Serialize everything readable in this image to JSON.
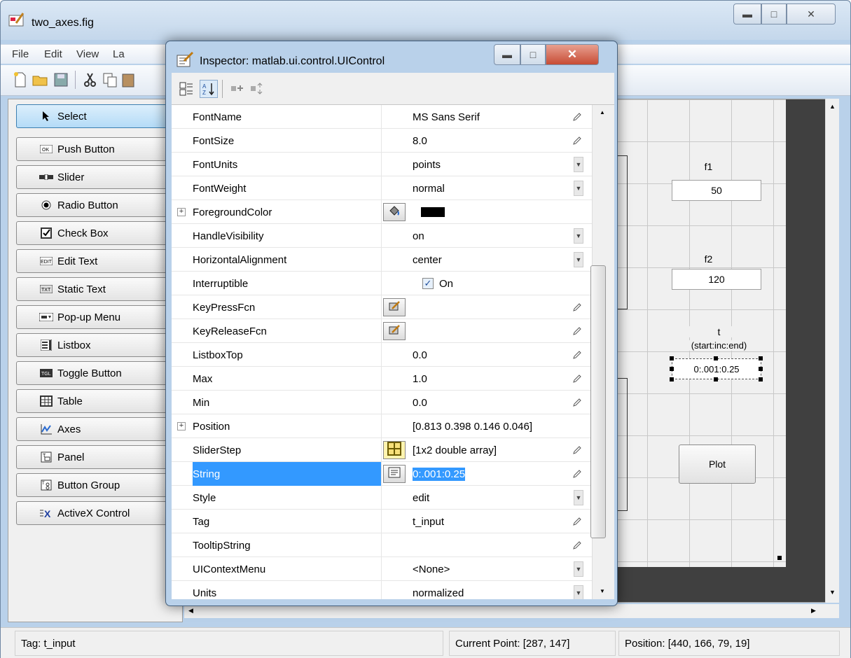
{
  "main_window": {
    "title": "two_axes.fig",
    "menu": [
      "File",
      "Edit",
      "View",
      "La"
    ]
  },
  "palette": {
    "items": [
      {
        "label": "Select",
        "icon": "cursor-arrow-icon",
        "selected": true
      },
      {
        "label": "Push Button",
        "icon": "push-button-icon"
      },
      {
        "label": "Slider",
        "icon": "slider-icon"
      },
      {
        "label": "Radio Button",
        "icon": "radio-button-icon"
      },
      {
        "label": "Check Box",
        "icon": "check-box-icon"
      },
      {
        "label": "Edit Text",
        "icon": "edit-text-icon"
      },
      {
        "label": "Static Text",
        "icon": "static-text-icon"
      },
      {
        "label": "Pop-up Menu",
        "icon": "popup-menu-icon"
      },
      {
        "label": "Listbox",
        "icon": "listbox-icon"
      },
      {
        "label": "Toggle Button",
        "icon": "toggle-button-icon"
      },
      {
        "label": "Table",
        "icon": "table-icon"
      },
      {
        "label": "Axes",
        "icon": "axes-icon"
      },
      {
        "label": "Panel",
        "icon": "panel-icon"
      },
      {
        "label": "Button Group",
        "icon": "button-group-icon"
      },
      {
        "label": "ActiveX Control",
        "icon": "activex-icon"
      }
    ]
  },
  "figure": {
    "f1_label": "f1",
    "f1_value": "50",
    "f2_label": "f2",
    "f2_value": "120",
    "t_label_1": "t",
    "t_label_2": "(start:inc:end)",
    "t_value": "0:.001:0.25",
    "plot_label": "Plot"
  },
  "status": {
    "tag": "Tag: t_input",
    "current_point": "Current Point:  [287, 147]",
    "position": "Position: [440, 166, 79, 19]"
  },
  "inspector": {
    "title": "Inspector:  matlab.ui.control.UIControl",
    "rows": [
      {
        "name": "FontName",
        "value": "MS Sans Serif",
        "ctrl": "edit"
      },
      {
        "name": "FontSize",
        "value": "8.0",
        "ctrl": "edit"
      },
      {
        "name": "FontUnits",
        "value": "points",
        "ctrl": "drop"
      },
      {
        "name": "FontWeight",
        "value": "normal",
        "ctrl": "drop"
      },
      {
        "name": "ForegroundColor",
        "value": "",
        "ctrl": "color",
        "expand": true,
        "swatch": "#000000"
      },
      {
        "name": "HandleVisibility",
        "value": "on",
        "ctrl": "drop"
      },
      {
        "name": "HorizontalAlignment",
        "value": "center",
        "ctrl": "drop"
      },
      {
        "name": "Interruptible",
        "value": "On",
        "ctrl": "check"
      },
      {
        "name": "KeyPressFcn",
        "value": "",
        "ctrl": "fcn"
      },
      {
        "name": "KeyReleaseFcn",
        "value": "",
        "ctrl": "fcn"
      },
      {
        "name": "ListboxTop",
        "value": "0.0",
        "ctrl": "edit"
      },
      {
        "name": "Max",
        "value": "1.0",
        "ctrl": "edit"
      },
      {
        "name": "Min",
        "value": "0.0",
        "ctrl": "edit"
      },
      {
        "name": "Position",
        "value": "[0.813 0.398 0.146 0.046]",
        "ctrl": "none",
        "expand": true
      },
      {
        "name": "SliderStep",
        "value": "[1x2  double array]",
        "ctrl": "array"
      },
      {
        "name": "String",
        "value": "0:.001:0.25",
        "ctrl": "string",
        "selected": true
      },
      {
        "name": "Style",
        "value": "edit",
        "ctrl": "drop"
      },
      {
        "name": "Tag",
        "value": "t_input",
        "ctrl": "edit"
      },
      {
        "name": "TooltipString",
        "value": "",
        "ctrl": "edit"
      },
      {
        "name": "UIContextMenu",
        "value": "<None>",
        "ctrl": "drop"
      },
      {
        "name": "Units",
        "value": "normalized",
        "ctrl": "drop"
      }
    ]
  },
  "colors": {
    "selection": "#3399ff",
    "title_bg": "#c4d7eb"
  }
}
